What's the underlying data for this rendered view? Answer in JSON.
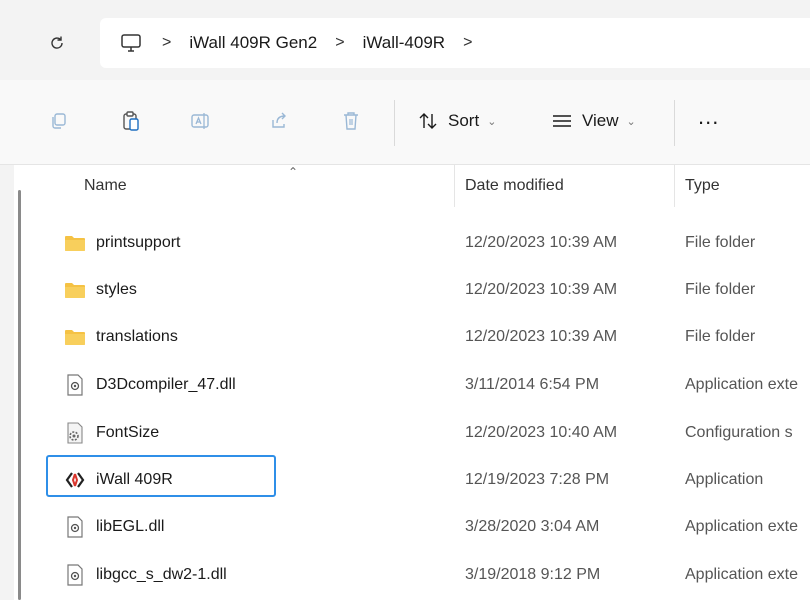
{
  "address_bar": {
    "breadcrumbs": [
      "iWall 409R Gen2",
      "iWall-409R"
    ],
    "separator": ">"
  },
  "toolbar": {
    "sort_label": "Sort",
    "view_label": "View",
    "more_label": "..."
  },
  "columns": {
    "name": "Name",
    "date": "Date modified",
    "type": "Type"
  },
  "files": [
    {
      "name": "printsupport",
      "date": "12/20/2023 10:39 AM",
      "type": "File folder",
      "icon": "folder-icon"
    },
    {
      "name": "styles",
      "date": "12/20/2023 10:39 AM",
      "type": "File folder",
      "icon": "folder-icon"
    },
    {
      "name": "translations",
      "date": "12/20/2023 10:39 AM",
      "type": "File folder",
      "icon": "folder-icon"
    },
    {
      "name": "D3Dcompiler_47.dll",
      "date": "3/11/2014 6:54 PM",
      "type": "Application exte",
      "icon": "dll-file-icon"
    },
    {
      "name": "FontSize",
      "date": "12/20/2023 10:40 AM",
      "type": "Configuration s",
      "icon": "config-file-icon"
    },
    {
      "name": "iWall 409R",
      "date": "12/19/2023 7:28 PM",
      "type": "Application",
      "icon": "app-icon",
      "selected": true
    },
    {
      "name": "libEGL.dll",
      "date": "3/28/2020 3:04 AM",
      "type": "Application exte",
      "icon": "dll-file-icon"
    },
    {
      "name": "libgcc_s_dw2-1.dll",
      "date": "3/19/2018 9:12 PM",
      "type": "Application exte",
      "icon": "dll-file-icon"
    }
  ],
  "colors": {
    "selection_border": "#2f8fe8",
    "folder": "#f5c244"
  }
}
